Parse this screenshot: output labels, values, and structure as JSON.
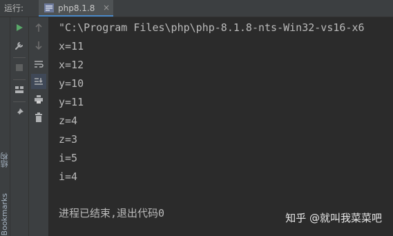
{
  "topbar": {
    "run_label": "运行:",
    "tab_title": "php8.1.8",
    "tab_close": "×"
  },
  "leftstrip": {
    "structure_label": "结构",
    "bookmarks_label": "Bookmarks"
  },
  "toolbar_left": [
    {
      "name": "rerun-icon",
      "color": "#59a869"
    },
    {
      "name": "wrench-icon"
    },
    {
      "name": "stop-icon"
    },
    {
      "name": "layout-icon"
    },
    {
      "name": "pin-icon"
    }
  ],
  "toolbar_right": [
    {
      "name": "up-arrow-icon"
    },
    {
      "name": "down-arrow-icon"
    },
    {
      "name": "soft-wrap-icon"
    },
    {
      "name": "scroll-to-end-icon"
    },
    {
      "name": "print-icon"
    },
    {
      "name": "trash-icon"
    }
  ],
  "console": {
    "lines": [
      "\"C:\\Program Files\\php\\php-8.1.8-nts-Win32-vs16-x6",
      "x=11",
      "x=12",
      "y=10",
      "y=11",
      "z=4",
      "z=3",
      "i=5",
      "i=4"
    ],
    "exit_message": "进程已结束,退出代码0"
  },
  "watermark": "知乎 @就叫我菜菜吧",
  "colors": {
    "background": "#2b2b2b",
    "panel": "#3c3f41",
    "text": "#bbbbbb",
    "accent": "#4a88c7"
  }
}
